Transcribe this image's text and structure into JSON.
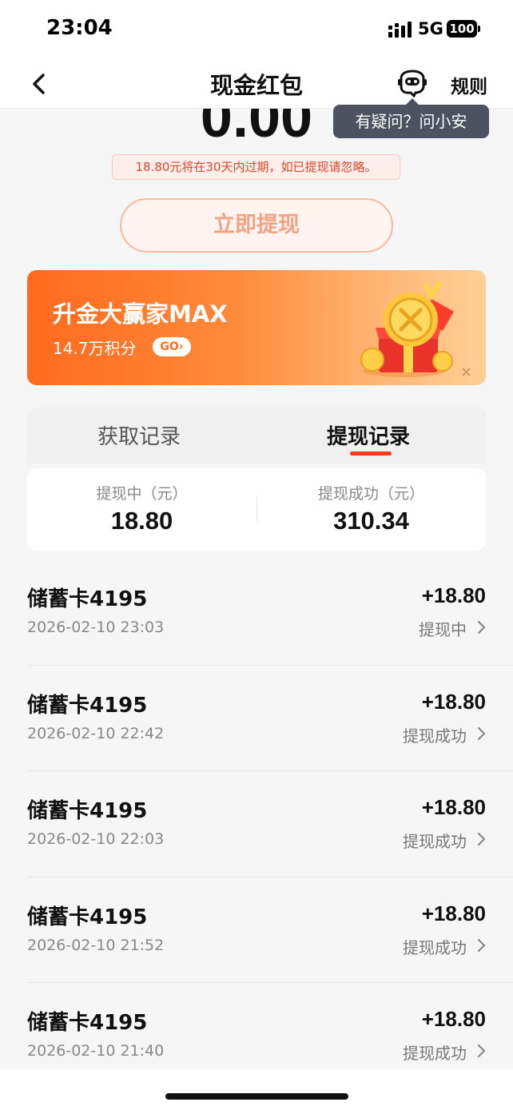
{
  "status_bar": {
    "time": "23:04",
    "network": "5G",
    "battery": "100"
  },
  "nav": {
    "title": "现金红包",
    "rules_label": "规则",
    "robot_icon": "robot-assistant-icon",
    "back_icon": "chevron-left-icon"
  },
  "tooltip": {
    "text": "有疑问？问小安"
  },
  "balance": {
    "amount": "0.00"
  },
  "notice": {
    "text": "18.80元将在30天内过期，如已提现请忽略。"
  },
  "withdraw_button": {
    "label": "立即提现"
  },
  "promo": {
    "title": "升金大赢家MAX",
    "subtitle": "14.7万积分",
    "go_label": "GO›",
    "close_label": "×"
  },
  "tabs": [
    {
      "label": "获取记录",
      "active": false
    },
    {
      "label": "提现记录",
      "active": true
    }
  ],
  "summary": {
    "pending_label": "提现中（元）",
    "pending_value": "18.80",
    "success_label": "提现成功（元）",
    "success_value": "310.34"
  },
  "records": [
    {
      "name": "储蓄卡4195",
      "date": "2026-02-10 23:03",
      "amount": "+18.80",
      "status": "提现中"
    },
    {
      "name": "储蓄卡4195",
      "date": "2026-02-10 22:42",
      "amount": "+18.80",
      "status": "提现成功"
    },
    {
      "name": "储蓄卡4195",
      "date": "2026-02-10 22:03",
      "amount": "+18.80",
      "status": "提现成功"
    },
    {
      "name": "储蓄卡4195",
      "date": "2026-02-10 21:52",
      "amount": "+18.80",
      "status": "提现成功"
    },
    {
      "name": "储蓄卡4195",
      "date": "2026-02-10 21:40",
      "amount": "+18.80",
      "status": "提现成功"
    }
  ],
  "colors": {
    "accent": "#f33a1b",
    "promo_start": "#ff6a1e",
    "promo_end": "#ffcf96",
    "notice_text": "#e0472a",
    "tooltip_bg": "#4d5260"
  }
}
